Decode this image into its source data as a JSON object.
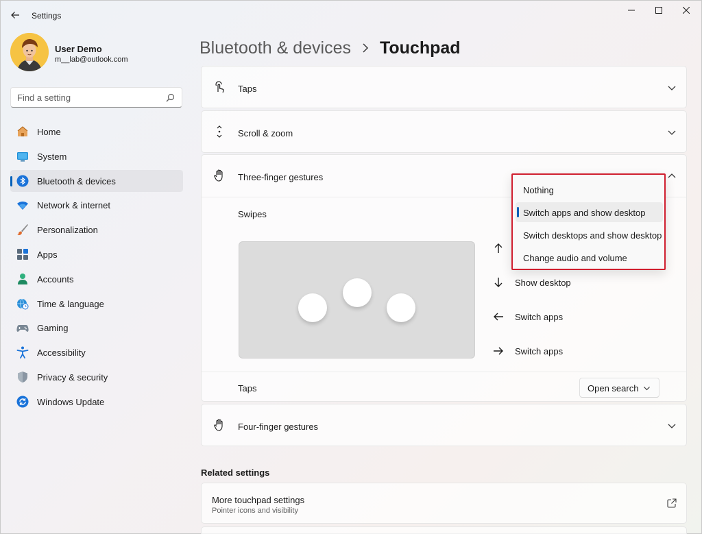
{
  "window": {
    "title": "Settings"
  },
  "profile": {
    "name": "User Demo",
    "email": "m__lab@outlook.com"
  },
  "search": {
    "placeholder": "Find a setting"
  },
  "sidebar": {
    "items": [
      {
        "label": "Home",
        "icon": "home-icon"
      },
      {
        "label": "System",
        "icon": "system-icon"
      },
      {
        "label": "Bluetooth & devices",
        "icon": "bluetooth-icon",
        "selected": true
      },
      {
        "label": "Network & internet",
        "icon": "wifi-icon"
      },
      {
        "label": "Personalization",
        "icon": "brush-icon"
      },
      {
        "label": "Apps",
        "icon": "apps-icon"
      },
      {
        "label": "Accounts",
        "icon": "accounts-icon"
      },
      {
        "label": "Time & language",
        "icon": "globe-clock-icon"
      },
      {
        "label": "Gaming",
        "icon": "gamepad-icon"
      },
      {
        "label": "Accessibility",
        "icon": "accessibility-icon"
      },
      {
        "label": "Privacy & security",
        "icon": "shield-icon"
      },
      {
        "label": "Windows Update",
        "icon": "update-icon"
      }
    ]
  },
  "header": {
    "parent": "Bluetooth & devices",
    "current": "Touchpad"
  },
  "sections": {
    "taps": "Taps",
    "scroll_zoom": "Scroll & zoom",
    "three_finger": "Three-finger gestures",
    "four_finger": "Four-finger gestures"
  },
  "three_finger": {
    "swipes_label": "Swipes",
    "swipes": [
      {
        "direction": "up",
        "label": "Switch apps and show desktop"
      },
      {
        "direction": "down",
        "label": "Show desktop"
      },
      {
        "direction": "left",
        "label": "Switch apps"
      },
      {
        "direction": "right",
        "label": "Switch apps"
      }
    ],
    "taps_label": "Taps",
    "taps_value": "Open search"
  },
  "flyout": {
    "options": [
      {
        "label": "Nothing"
      },
      {
        "label": "Switch apps and show desktop",
        "selected": true
      },
      {
        "label": "Switch desktops and show desktop"
      },
      {
        "label": "Change audio and volume"
      }
    ]
  },
  "related": {
    "title": "Related settings",
    "items": [
      {
        "title": "More touchpad settings",
        "subtitle": "Pointer icons and visibility"
      }
    ]
  },
  "colors": {
    "accent": "#005fb8",
    "highlight_border": "#d01f2f"
  }
}
